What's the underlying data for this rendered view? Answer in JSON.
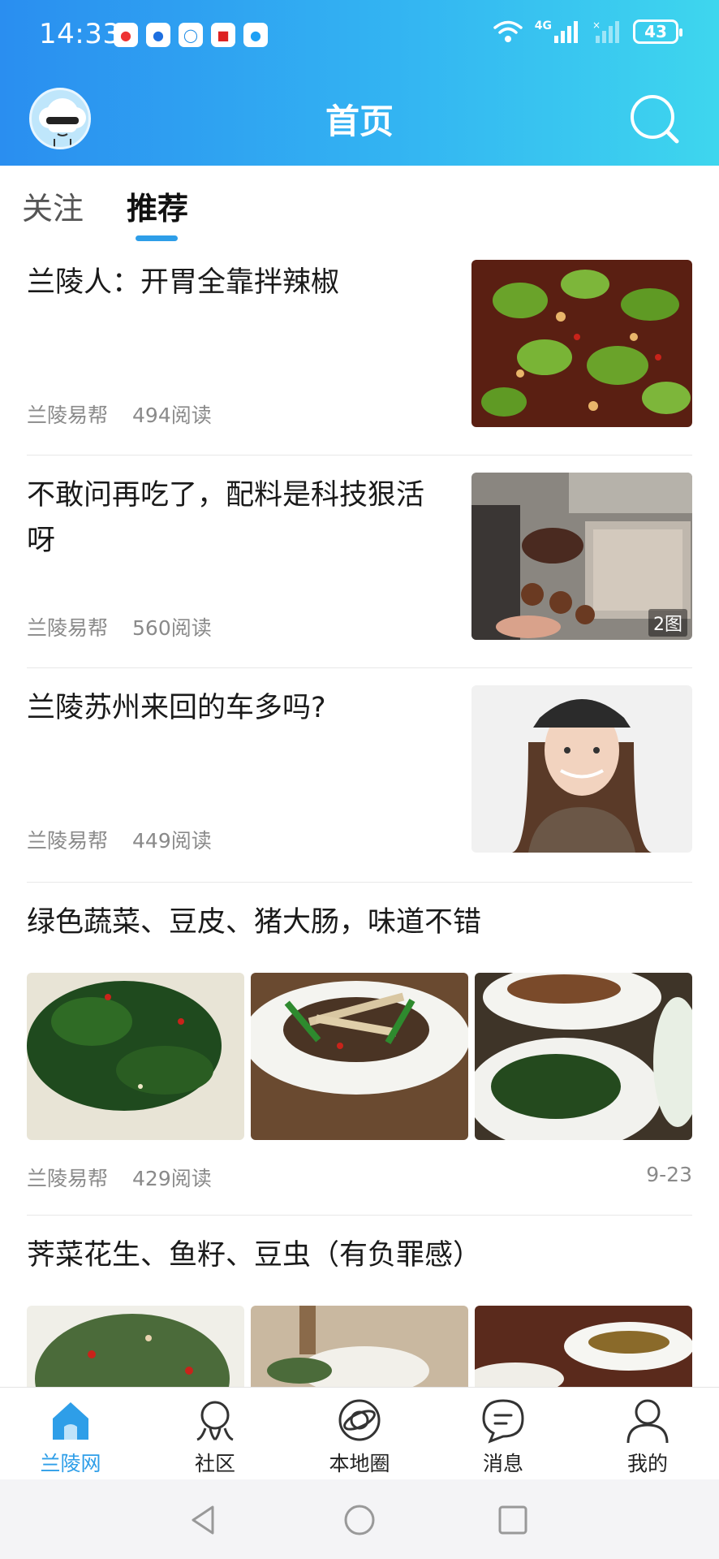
{
  "status_bar": {
    "time": "14:33",
    "battery": "43",
    "network": "4G"
  },
  "header": {
    "title": "首页"
  },
  "tabs": [
    {
      "label": "关注",
      "active": false
    },
    {
      "label": "推荐",
      "active": true
    }
  ],
  "articles": [
    {
      "title": "兰陵人：开胃全靠拌辣椒",
      "source": "兰陵易帮",
      "reads": "494阅读",
      "image_badge": ""
    },
    {
      "title": "不敢问再吃了，配料是科技狠活呀",
      "source": "兰陵易帮",
      "reads": "560阅读",
      "image_badge": "2图"
    },
    {
      "title": "兰陵苏州来回的车多吗?",
      "source": "兰陵易帮",
      "reads": "449阅读",
      "image_badge": ""
    },
    {
      "title": "绿色蔬菜、豆皮、猪大肠，味道不错",
      "source": "兰陵易帮",
      "reads": "429阅读",
      "date": "9-23"
    },
    {
      "title": "荠菜花生、鱼籽、豆虫（有负罪感）"
    }
  ],
  "bottom_nav": [
    {
      "label": "兰陵网",
      "icon": "home-icon",
      "active": true
    },
    {
      "label": "社区",
      "icon": "community-icon",
      "active": false
    },
    {
      "label": "本地圈",
      "icon": "local-circle-icon",
      "active": false
    },
    {
      "label": "消息",
      "icon": "message-icon",
      "active": false
    },
    {
      "label": "我的",
      "icon": "profile-icon",
      "active": false
    }
  ],
  "colors": {
    "header_gradient_start": "#2a8ef0",
    "header_gradient_end": "#3ed6ee",
    "accent": "#2e9ee8",
    "meta_text": "#8a8a8a"
  }
}
